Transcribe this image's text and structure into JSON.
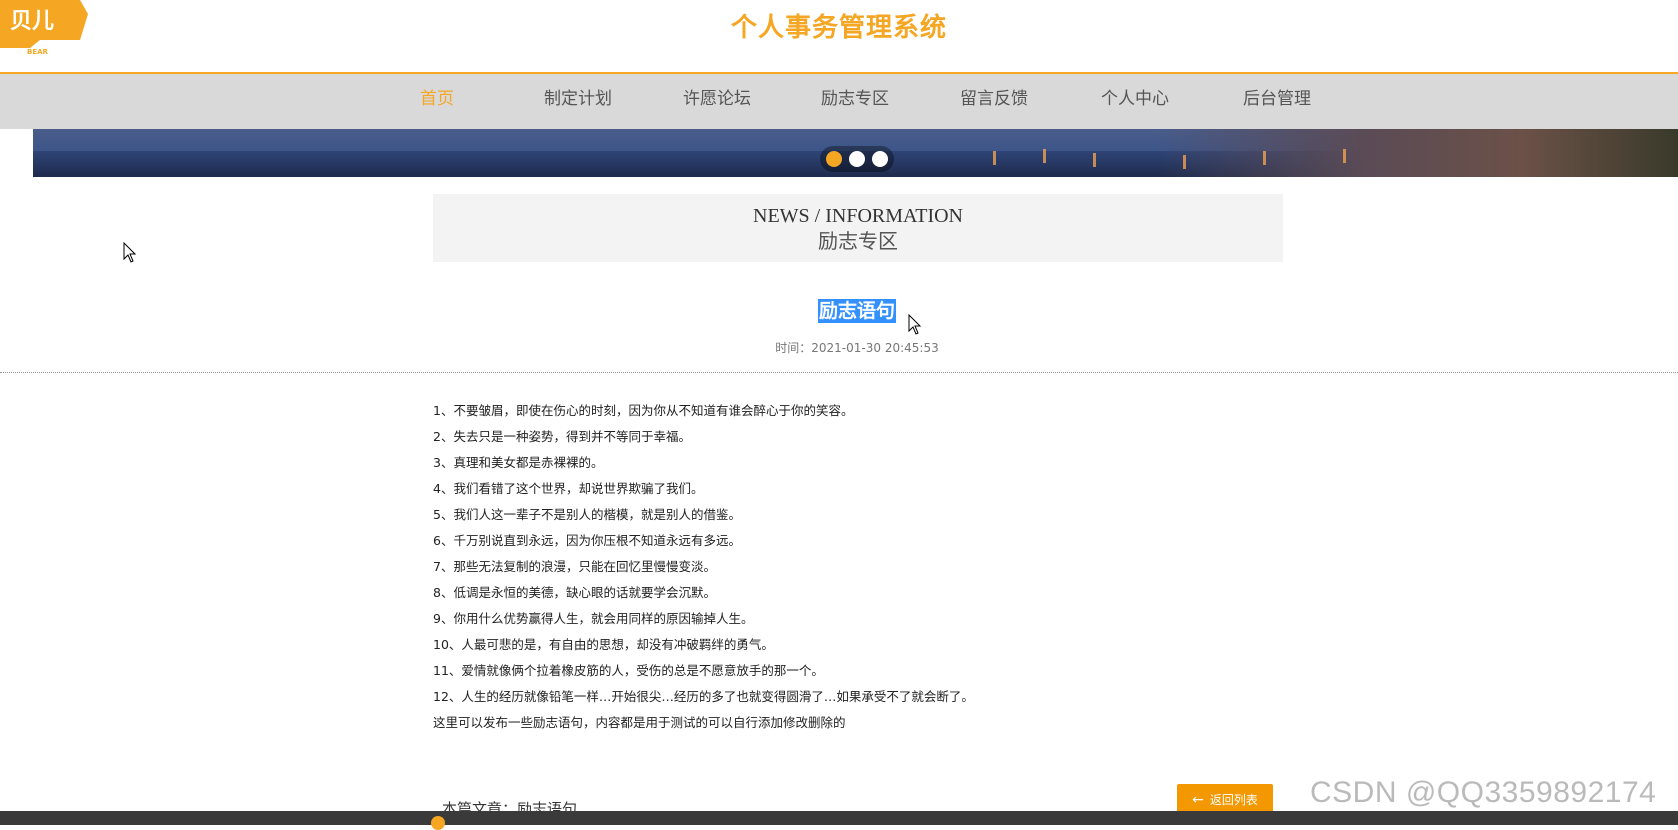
{
  "header": {
    "logo_text": "贝儿",
    "logo_sub": "BEAR",
    "title": "个人事务管理系统"
  },
  "nav": {
    "items": [
      {
        "label": "首页",
        "active": true
      },
      {
        "label": "制定计划",
        "active": false
      },
      {
        "label": "许愿论坛",
        "active": false
      },
      {
        "label": "励志专区",
        "active": false
      },
      {
        "label": "留言反馈",
        "active": false
      },
      {
        "label": "个人中心",
        "active": false
      },
      {
        "label": "后台管理",
        "active": false
      }
    ]
  },
  "banner": {
    "slide_count": 3,
    "active_slide": 0
  },
  "section": {
    "en_title": "NEWS / INFORMATION",
    "cn_title": "励志专区"
  },
  "article": {
    "title": "励志语句",
    "time": "时间：2021-01-30 20:45:53",
    "lines": [
      "1、不要皱眉，即使在伤心的时刻，因为你从不知道有谁会醉心于你的笑容。",
      "2、失去只是一种姿势，得到并不等同于幸福。",
      "3、真理和美女都是赤裸裸的。",
      "4、我们看错了这个世界，却说世界欺骗了我们。",
      "5、我们人这一辈子不是别人的楷模，就是别人的借鉴。",
      "6、千万别说直到永远，因为你压根不知道永远有多远。",
      "7、那些无法复制的浪漫，只能在回忆里慢慢变淡。",
      "8、低调是永恒的美德，缺心眼的话就要学会沉默。",
      "9、你用什么优势赢得人生，就会用同样的原因输掉人生。",
      "10、人最可悲的是，有自由的思想，却没有冲破羁绊的勇气。",
      "11、爱情就像俩个拉着橡皮筋的人，受伤的总是不愿意放手的那一个。",
      "12、人生的经历就像铅笔一样…开始很尖…经历的多了也就变得圆滑了…如果承受不了就会断了。",
      "这里可以发布一些励志语句，内容都是用于测试的可以自行添加修改删除的"
    ]
  },
  "footer": {
    "back_label": "返回列表",
    "this_article": "本篇文章：励志语句"
  },
  "watermark": "CSDN @QQ3359892174",
  "colors": {
    "accent": "#f5a623",
    "nav_bg": "#d9d9d9",
    "button": "#f39800",
    "selection": "#3390ff"
  }
}
